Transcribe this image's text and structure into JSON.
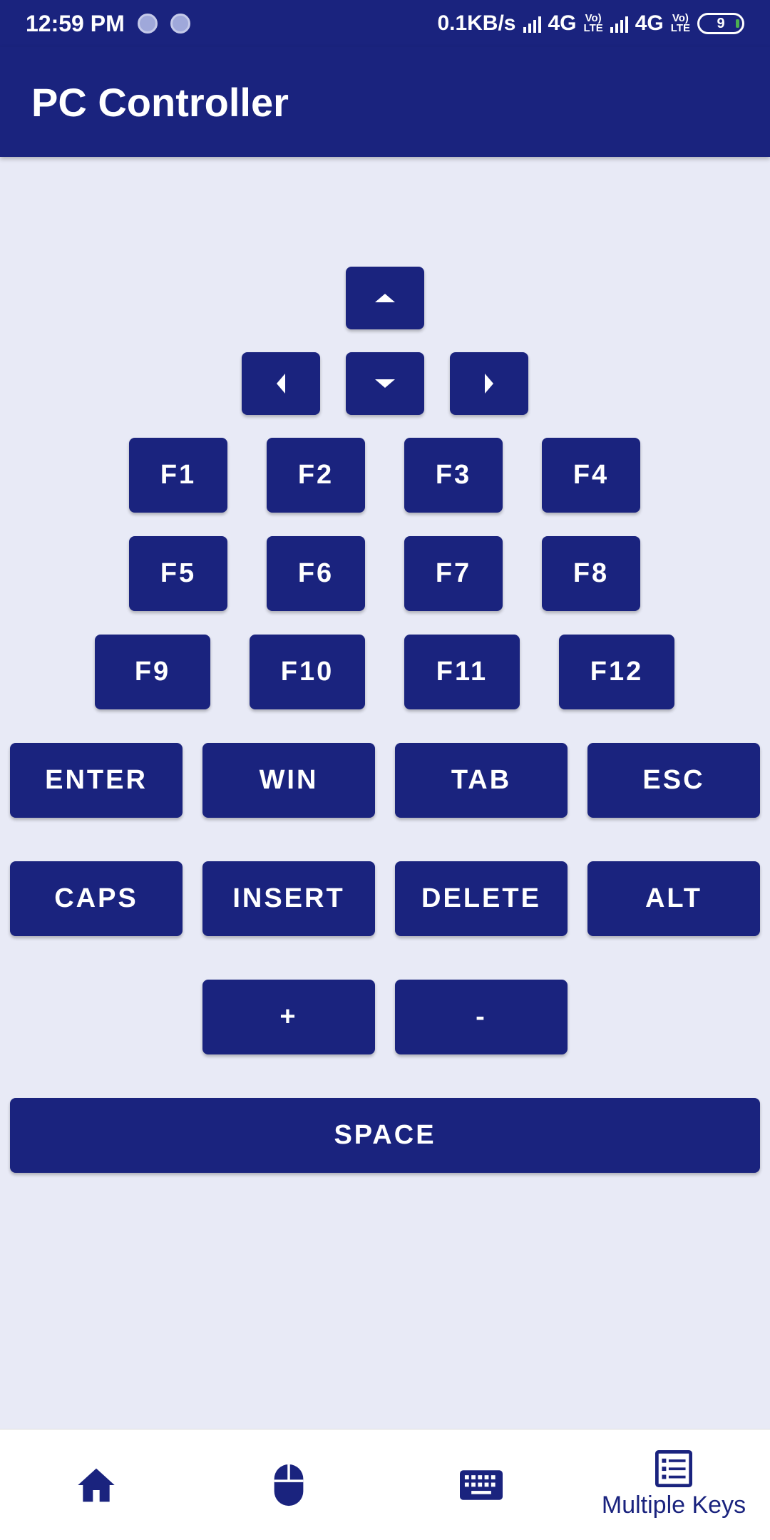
{
  "status": {
    "time": "12:59 PM",
    "speed": "0.1KB/s",
    "network1": "4G",
    "network2": "4G",
    "volte": "Vo) LTE",
    "battery": "9"
  },
  "app_bar": {
    "title": "PC Controller"
  },
  "keys": {
    "arrows": {
      "up": "up-arrow-icon",
      "down": "down-arrow-icon",
      "left": "left-arrow-icon",
      "right": "right-arrow-icon"
    },
    "f1": "F1",
    "f2": "F2",
    "f3": "F3",
    "f4": "F4",
    "f5": "F5",
    "f6": "F6",
    "f7": "F7",
    "f8": "F8",
    "f9": "F9",
    "f10": "F10",
    "f11": "F11",
    "f12": "F12",
    "enter": "ENTER",
    "win": "WIN",
    "tab": "TAB",
    "esc": "ESC",
    "caps": "CAPS",
    "insert": "INSERT",
    "delete": "DELETE",
    "alt": "ALT",
    "plus": "+",
    "minus": "-",
    "space": "SPACE"
  },
  "bottom_nav": {
    "items": [
      {
        "icon": "home-icon",
        "label": ""
      },
      {
        "icon": "mouse-icon",
        "label": ""
      },
      {
        "icon": "keyboard-icon",
        "label": ""
      },
      {
        "icon": "list-icon",
        "label": "Multiple Keys"
      }
    ]
  },
  "colors": {
    "primary": "#1a237e",
    "background": "#e8eaf6"
  }
}
